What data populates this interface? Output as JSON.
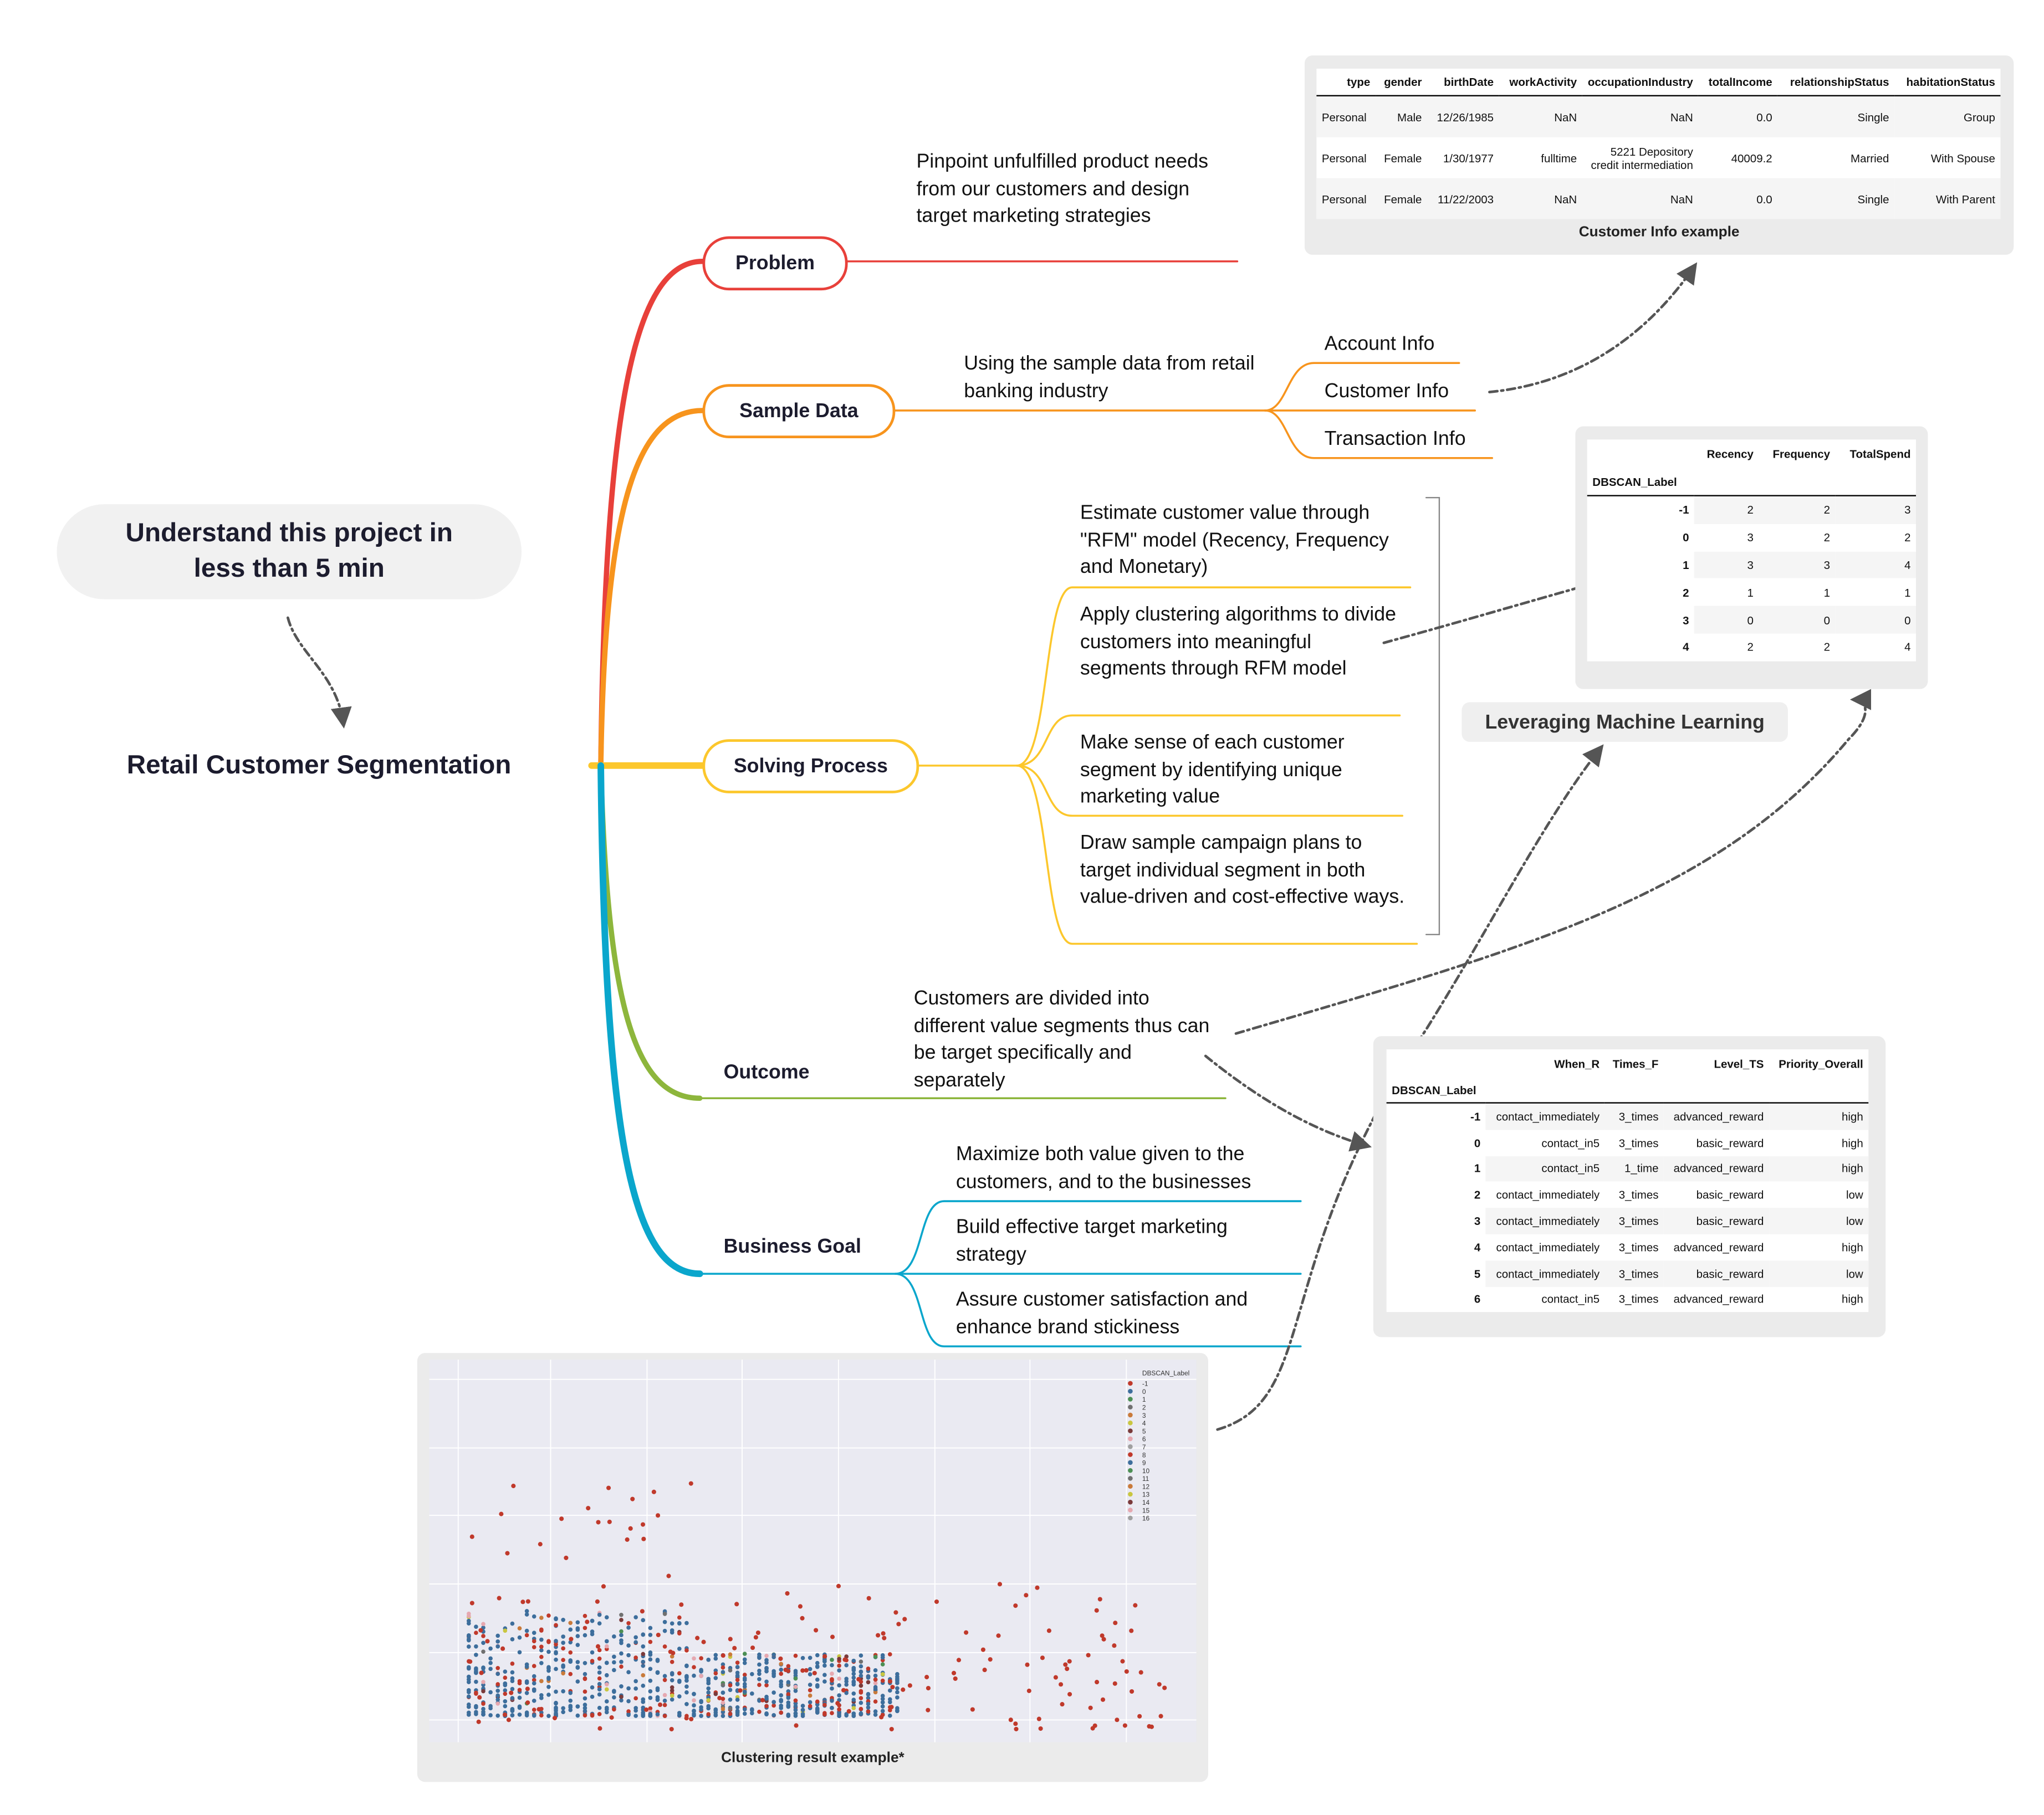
{
  "intro": {
    "text": "Understand this project in less than 5 min"
  },
  "root": {
    "title": "Retail Customer Segmentation"
  },
  "colors": {
    "problem": "#e8403a",
    "sample": "#f7941d",
    "solving": "#fcc72c",
    "outcome": "#8db63c",
    "goal": "#0aa6cc",
    "arrow": "#555555"
  },
  "problem": {
    "label": "Problem",
    "text": "Pinpoint unfulfilled product needs from our customers and design target marketing strategies"
  },
  "sample": {
    "label": "Sample Data",
    "text": "Using the sample data from retail banking industry",
    "items": [
      "Account Info",
      "Customer Info",
      "Transaction Info"
    ]
  },
  "solving": {
    "label": "Solving Process",
    "items": [
      "Estimate customer value through \"RFM\" model (Recency, Frequency and Monetary)",
      "Apply clustering algorithms to divide customers into meaningful segments through RFM model",
      "Make sense of each customer segment by identifying unique marketing value",
      "Draw sample campaign plans to target individual segment in both value-driven and cost-effective ways."
    ],
    "ml_label": "Leveraging Machine Learning"
  },
  "outcome": {
    "label": "Outcome",
    "text": "Customers are divided into different value segments thus can be target specifically and separately"
  },
  "goal": {
    "label": "Business Goal",
    "items": [
      "Maximize both value given to the customers, and to the businesses",
      "Build effective target marketing strategy",
      "Assure customer satisfaction and enhance brand stickiness"
    ]
  },
  "customer_table": {
    "caption": "Customer Info example",
    "columns": [
      "type",
      "gender",
      "birthDate",
      "workActivity",
      "occupationIndustry",
      "totalIncome",
      "relationshipStatus",
      "habitationStatus"
    ],
    "rows": [
      [
        "Personal",
        "Male",
        "12/26/1985",
        "NaN",
        "NaN",
        "0.0",
        "Single",
        "Group"
      ],
      [
        "Personal",
        "Female",
        "1/30/1977",
        "fulltime",
        "5221 Depository credit intermediation",
        "40009.2",
        "Married",
        "With Spouse"
      ],
      [
        "Personal",
        "Female",
        "11/22/2003",
        "NaN",
        "NaN",
        "0.0",
        "Single",
        "With Parent"
      ]
    ]
  },
  "rfm_table": {
    "index_name": "DBSCAN_Label",
    "columns": [
      "Recency",
      "Frequency",
      "TotalSpend"
    ],
    "rows": [
      [
        "-1",
        "2",
        "2",
        "3"
      ],
      [
        "0",
        "3",
        "2",
        "2"
      ],
      [
        "1",
        "3",
        "3",
        "4"
      ],
      [
        "2",
        "1",
        "1",
        "1"
      ],
      [
        "3",
        "0",
        "0",
        "0"
      ],
      [
        "4",
        "2",
        "2",
        "4"
      ]
    ]
  },
  "action_table": {
    "index_name": "DBSCAN_Label",
    "columns": [
      "When_R",
      "Times_F",
      "Level_TS",
      "Priority_Overall"
    ],
    "rows": [
      [
        "-1",
        "contact_immediately",
        "3_times",
        "advanced_reward",
        "high"
      ],
      [
        "0",
        "contact_in5",
        "3_times",
        "basic_reward",
        "high"
      ],
      [
        "1",
        "contact_in5",
        "1_time",
        "advanced_reward",
        "high"
      ],
      [
        "2",
        "contact_immediately",
        "3_times",
        "basic_reward",
        "low"
      ],
      [
        "3",
        "contact_immediately",
        "3_times",
        "basic_reward",
        "low"
      ],
      [
        "4",
        "contact_immediately",
        "3_times",
        "advanced_reward",
        "high"
      ],
      [
        "5",
        "contact_immediately",
        "3_times",
        "basic_reward",
        "low"
      ],
      [
        "6",
        "contact_in5",
        "3_times",
        "advanced_reward",
        "high"
      ]
    ]
  },
  "scatter": {
    "caption": "Clustering result example*",
    "legend_title": "DBSCAN_Label",
    "legend": [
      {
        "label": "-1",
        "color": "#c0392b"
      },
      {
        "label": "0",
        "color": "#3d6e9c"
      },
      {
        "label": "1",
        "color": "#4c8f54"
      },
      {
        "label": "2",
        "color": "#707070"
      },
      {
        "label": "3",
        "color": "#c97a3a"
      },
      {
        "label": "4",
        "color": "#c9c640"
      },
      {
        "label": "5",
        "color": "#7a3a3a"
      },
      {
        "label": "6",
        "color": "#e6a8b0"
      },
      {
        "label": "7",
        "color": "#a0a0a0"
      },
      {
        "label": "8",
        "color": "#c0392b"
      },
      {
        "label": "9",
        "color": "#3d6e9c"
      },
      {
        "label": "10",
        "color": "#4c8f54"
      },
      {
        "label": "11",
        "color": "#707070"
      },
      {
        "label": "12",
        "color": "#c97a3a"
      },
      {
        "label": "13",
        "color": "#c9c640"
      },
      {
        "label": "14",
        "color": "#7a3a3a"
      },
      {
        "label": "15",
        "color": "#e6a8b0"
      },
      {
        "label": "16",
        "color": "#a0a0a0"
      }
    ]
  }
}
